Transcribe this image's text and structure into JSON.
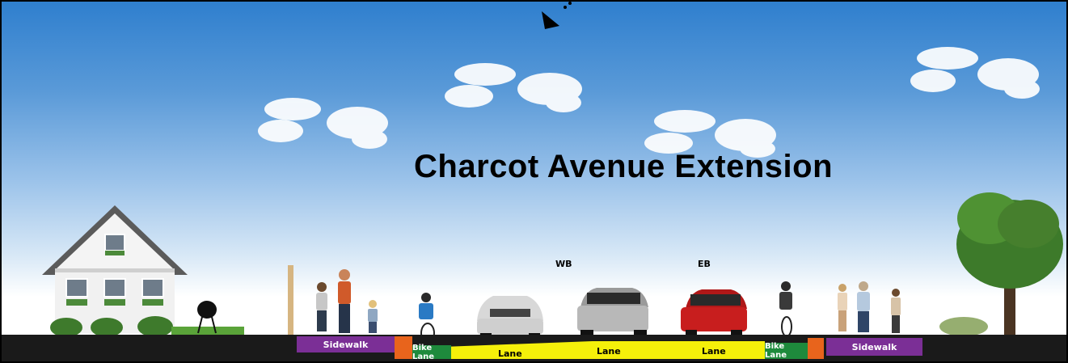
{
  "title": "Charcot Avenue Extension",
  "direction_labels": {
    "westbound": "WB",
    "eastbound": "EB"
  },
  "segments": {
    "left_sidewalk": "Sidewalk",
    "left_bike_lane": "Bike Lane",
    "lane_1": "Lane",
    "lane_2": "Lane",
    "lane_3": "Lane",
    "right_bike_lane": "Bike Lane",
    "right_sidewalk": "Sidewalk"
  },
  "colors": {
    "sidewalk": "#7b2f96",
    "bike_lane": "#1e8a3c",
    "buffer": "#e8641c",
    "travel_lane": "#f5f00a",
    "ground": "#1a1a1a"
  }
}
